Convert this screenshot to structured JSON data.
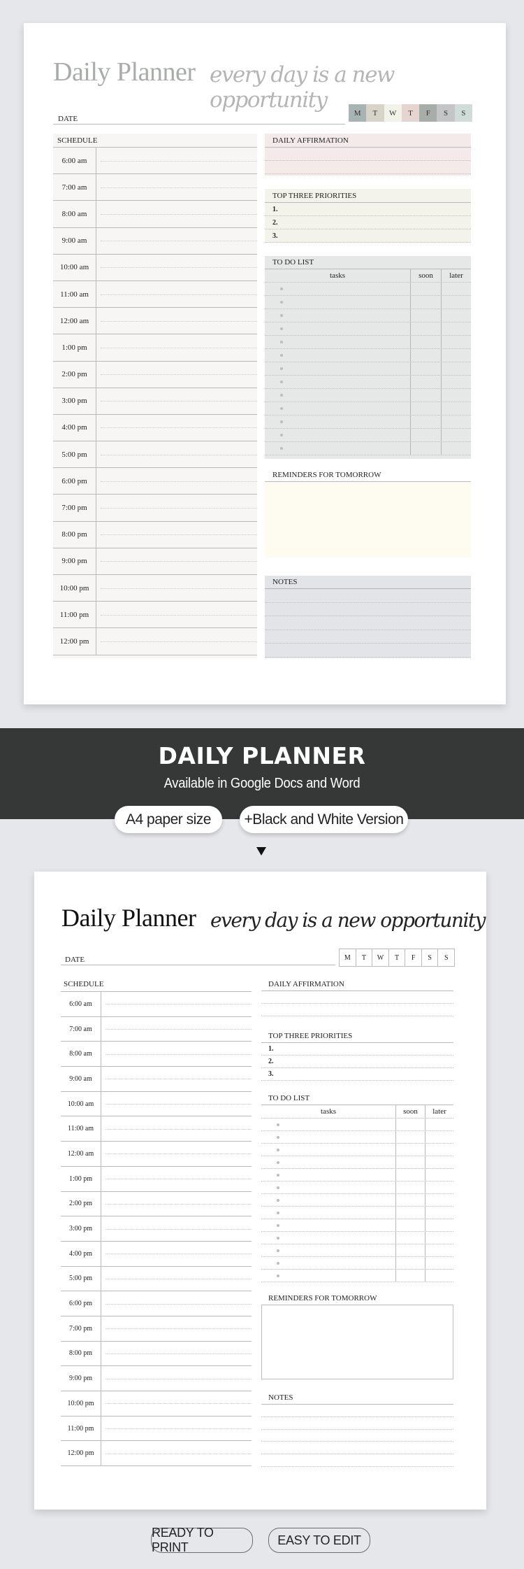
{
  "planner": {
    "title": "Daily Planner",
    "tagline": "every day is a new opportunity",
    "date_label": "DATE",
    "days": [
      "M",
      "T",
      "W",
      "T",
      "F",
      "S",
      "S"
    ],
    "day_colors": [
      "#a8b3b4",
      "#d7d3c9",
      "#f1f2ea",
      "#e6d4d1",
      "#a7aeaa",
      "#c4c5c6",
      "#cfdcd8"
    ],
    "schedule": {
      "heading": "SCHEDULE",
      "times": [
        "6:00 am",
        "7:00 am",
        "8:00 am",
        "9:00 am",
        "10:00 am",
        "11:00 am",
        "12:00 am",
        "1:00 pm",
        "2:00 pm",
        "3:00 pm",
        "4:00 pm",
        "5:00 pm",
        "6:00 pm",
        "7:00 pm",
        "8:00 pm",
        "9:00 pm",
        "10:00 pm",
        "11:00 pm",
        "12:00 pm"
      ]
    },
    "affirmation": {
      "heading": "DAILY AFFIRMATION"
    },
    "priorities": {
      "heading": "TOP THREE PRIORITIES",
      "items": [
        "1.",
        "2.",
        "3."
      ]
    },
    "todo": {
      "heading": "TO DO LIST",
      "col_tasks": "tasks",
      "col_soon": "soon",
      "col_later": "later",
      "row_count": 13
    },
    "reminders": {
      "heading": "REMINDERS FOR TOMORROW"
    },
    "notes": {
      "heading": "NOTES"
    }
  },
  "banner": {
    "title": "DAILY PLANNER",
    "subtitle": "Available in Google Docs and Word",
    "pill_1": "A4 paper size",
    "pill_2": "+Black and White Version"
  },
  "footer": {
    "badge_1": "READY TO PRINT",
    "badge_2": "EASY TO EDIT"
  },
  "colors": {
    "schedule_bg": "#f8f5f5",
    "affirmation_bg": "#f5eaea",
    "priorities_bg": "#f3f3ec",
    "todo_bg": "#e6e8e7",
    "reminders_bg": "#fefcf0",
    "notes_bg": "#e2e4e8",
    "banner_bg": "#363838"
  }
}
